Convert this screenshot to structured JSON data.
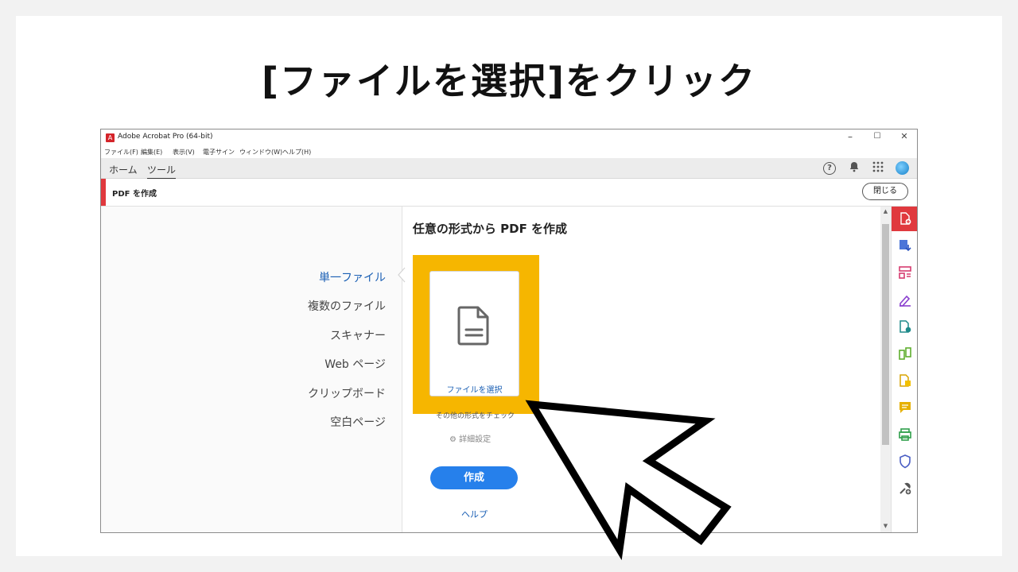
{
  "slide": {
    "title": "[ファイルを選択]をクリック"
  },
  "window": {
    "title": "Adobe Acrobat Pro (64-bit)",
    "controls": {
      "minimize": "–",
      "maximize": "☐",
      "close": "✕"
    }
  },
  "menubar": [
    "ファイル(F)",
    "編集(E)",
    "表示(V)",
    "電子サイン",
    "ウィンドウ(W)",
    "ヘルプ(H)"
  ],
  "nav": {
    "tabs": [
      "ホーム",
      "ツール"
    ],
    "icons": {
      "help": "?",
      "bell": "🔔",
      "apps": "⋮⋮"
    }
  },
  "tool": {
    "title": "PDF を作成",
    "close_label": "閉じる"
  },
  "panel": {
    "heading": "任意の形式から PDF を作成",
    "types": [
      "単一ファイル",
      "複数のファイル",
      "スキャナー",
      "Web ページ",
      "クリップボード",
      "空白ページ"
    ],
    "select_file": "ファイルを選択",
    "other_formats": "その他の形式をチェック",
    "advanced": "詳細設定",
    "create": "作成",
    "help": "ヘルプ"
  },
  "colors": {
    "accent_red": "#e0393e",
    "link_blue": "#1a5fb4",
    "create_blue": "#2680eb",
    "highlight": "#f6b600"
  }
}
